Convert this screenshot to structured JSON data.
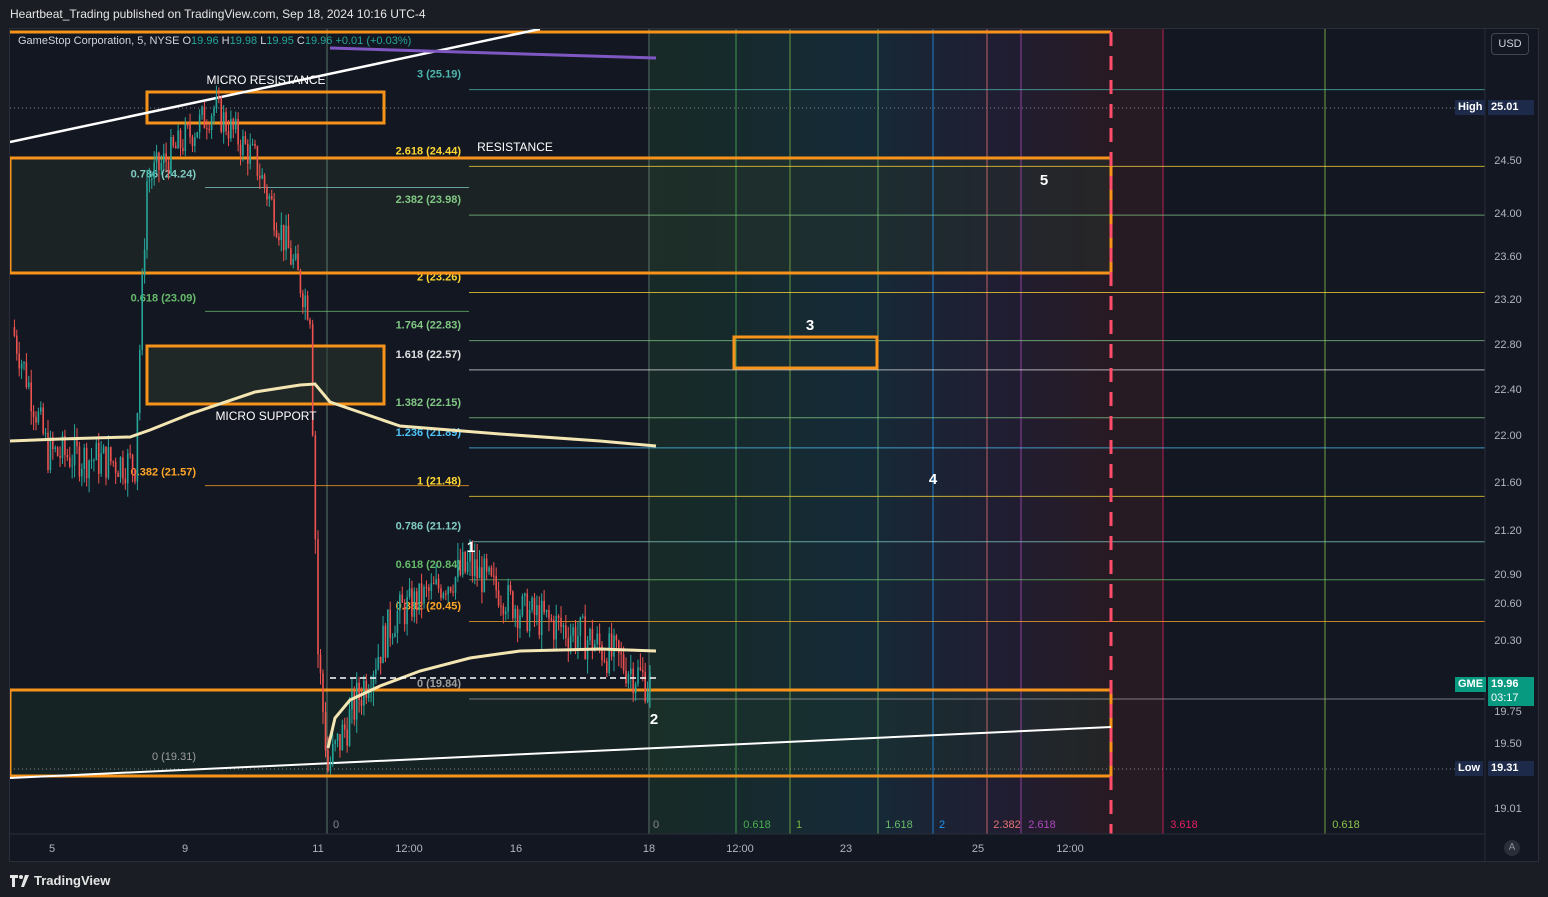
{
  "publisher_text": "Heartbeat_Trading published on TradingView.com, Sep 18, 2024 10:16 UTC-4",
  "legend": {
    "symbol": "GameStop Corporation, 5, NYSE",
    "open_label": "O",
    "open": "19.96",
    "high_label": "H",
    "high": "19.98",
    "low_label": "L",
    "low": "19.95",
    "close_label": "C",
    "close": "19.96",
    "change": "+0.01 (+0.03%)"
  },
  "currency_button": "USD",
  "footer_logo": "TradingView",
  "auto_scale_label": "A",
  "price_tags": {
    "high_label": "High",
    "high_value": "25.01",
    "low_label": "Low",
    "low_value": "19.31",
    "symbol_label": "GME",
    "last_price": "19.96",
    "countdown": "03:17"
  },
  "colors": {
    "background": "#131722",
    "orange_box": "#f7931a",
    "bullish": "#26a69a",
    "bearish": "#ef5350",
    "vwap": "#f3e6b3",
    "trendline": "#ffffff"
  },
  "chart_data": {
    "type": "candlestick",
    "symbol": "GME",
    "timeframe": "5",
    "y_axis_ticks": [
      "24.50",
      "24.00",
      "23.60",
      "23.20",
      "22.80",
      "22.40",
      "22.00",
      "21.60",
      "21.20",
      "20.90",
      "20.60",
      "20.30",
      "19.75",
      "19.50",
      "19.01"
    ],
    "x_axis_ticks": [
      "5",
      "9",
      "11",
      "12:00",
      "16",
      "18",
      "12:00",
      "23",
      "25",
      "12:00"
    ],
    "ylim": [
      18.9,
      25.6
    ],
    "price_path": [
      {
        "session": "Sep 5",
        "price": 22.95
      },
      {
        "session": "Sep 6",
        "price": 21.85
      },
      {
        "session": "Sep 6 late",
        "price": 21.75
      },
      {
        "session": "Sep 9 open",
        "price": 24.3
      },
      {
        "session": "Sep 9 high",
        "price": 25.01
      },
      {
        "session": "Sep 10",
        "price": 24.5
      },
      {
        "session": "Sep 10 close",
        "price": 23.1
      },
      {
        "session": "Sep 11 open",
        "price": 20.2
      },
      {
        "session": "Sep 11 low",
        "price": 19.31
      },
      {
        "session": "Sep 12",
        "price": 20.5
      },
      {
        "session": "Sep 13",
        "price": 20.95
      },
      {
        "session": "Sep 16",
        "price": 20.55
      },
      {
        "session": "Sep 17",
        "price": 20.3
      },
      {
        "session": "Sep 18",
        "price": 19.96
      }
    ],
    "fib_upper": [
      {
        "label": "0.786 (24.24)",
        "price": 24.24
      },
      {
        "label": "0.618 (23.09)",
        "price": 23.09
      },
      {
        "label": "0.382 (21.57)",
        "price": 21.57
      }
    ],
    "fib_extension": [
      {
        "label": "3 (25.19)",
        "price": 25.19
      },
      {
        "label": "2.618 (24.44)",
        "price": 24.44
      },
      {
        "label": "2.382 (23.98)",
        "price": 23.98
      },
      {
        "label": "2 (23.26)",
        "price": 23.26
      },
      {
        "label": "1.764 (22.83)",
        "price": 22.83
      },
      {
        "label": "1.618 (22.57)",
        "price": 22.57
      },
      {
        "label": "1.382 (22.15)",
        "price": 22.15
      },
      {
        "label": "1.236 (21.89)",
        "price": 21.89
      },
      {
        "label": "1 (21.48)",
        "price": 21.48
      },
      {
        "label": "0.786 (21.12)",
        "price": 21.12
      },
      {
        "label": "0.618 (20.84)",
        "price": 20.84
      },
      {
        "label": "0.382 (20.45)",
        "price": 20.45
      },
      {
        "label": "0 (19.84)",
        "price": 19.84
      }
    ],
    "fib_lower_label": "0 (19.31)",
    "fib_time_labels": [
      "0",
      "0",
      "0.618",
      "1",
      "1.618",
      "2",
      "2.382",
      "2.618",
      "3.618",
      "0.618"
    ],
    "annotations": [
      "MICRO RESISTANCE",
      "RESISTANCE",
      "MICRO SUPPORT"
    ],
    "wave_labels": [
      "1",
      "2",
      "3",
      "4",
      "5"
    ]
  }
}
